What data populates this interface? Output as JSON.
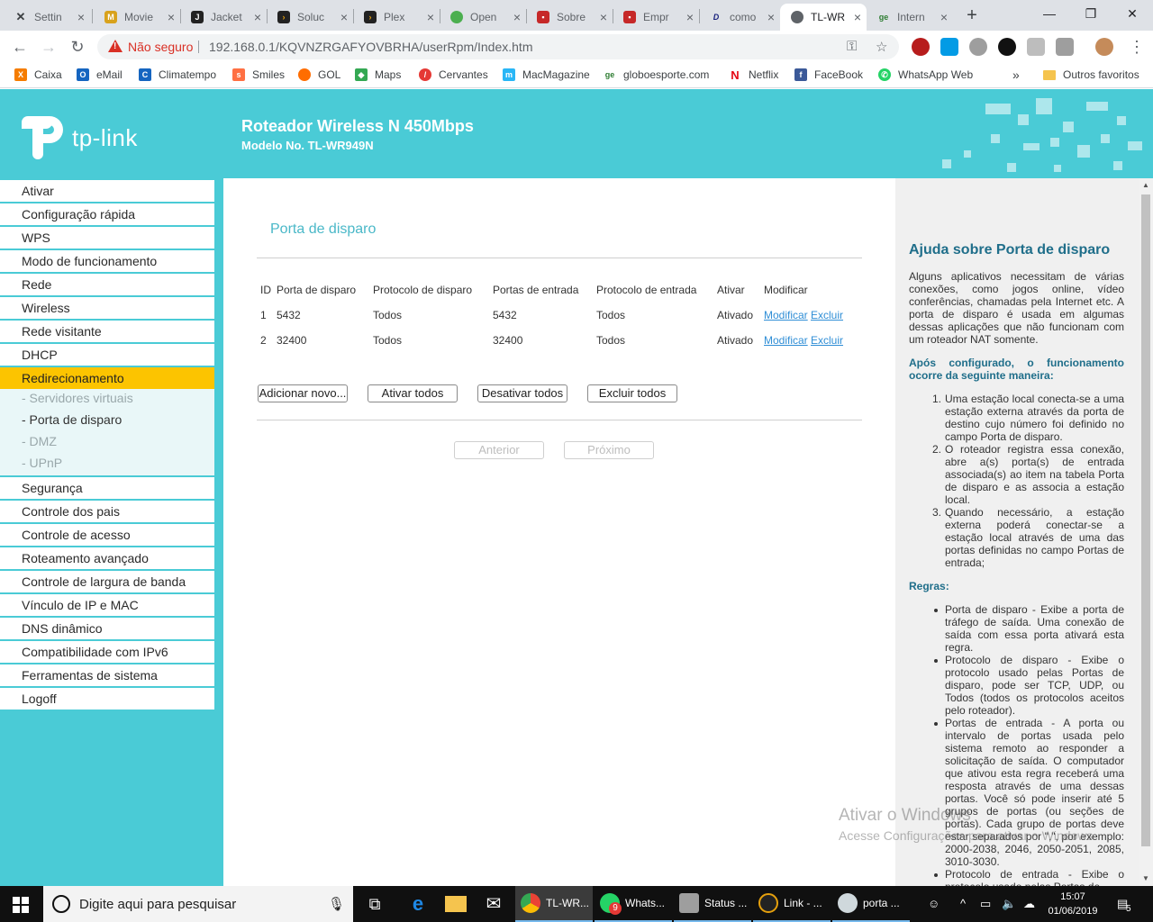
{
  "browser": {
    "tabs": [
      {
        "label": "Settin",
        "color": "#3c4043"
      },
      {
        "label": "Movie",
        "color": "#d8a21c"
      },
      {
        "label": "Jacket",
        "color": "#222222"
      },
      {
        "label": "Soluc",
        "color": "#e5a00d"
      },
      {
        "label": "Plex",
        "color": "#e5a00d"
      },
      {
        "label": "Open",
        "color": "#4caf50"
      },
      {
        "label": "Sobre",
        "color": "#c62828"
      },
      {
        "label": "Empr",
        "color": "#c62828"
      },
      {
        "label": "como",
        "color": "#1a237e"
      },
      {
        "label": "TL-WR",
        "color": "#5f6368"
      },
      {
        "label": "Intern",
        "color": "#2e7d32"
      }
    ],
    "not_secure": "Não seguro",
    "url": "192.168.0.1/KQVNZRGAFYOVBRHA/userRpm/Index.htm",
    "bookmarks": [
      {
        "label": "Caixa",
        "color": "#f57c00"
      },
      {
        "label": "eMail",
        "color": "#1565c0"
      },
      {
        "label": "Climatempo",
        "color": "#1565c0"
      },
      {
        "label": "Smiles",
        "color": "#ff7043"
      },
      {
        "label": "GOL",
        "color": "#ff6d00"
      },
      {
        "label": "Maps",
        "color": "#34a853"
      },
      {
        "label": "Cervantes",
        "color": "#e53935"
      },
      {
        "label": "MacMagazine",
        "color": "#29b6f6"
      },
      {
        "label": "globoesporte.com",
        "color": "#2e7d32"
      },
      {
        "label": "Netflix",
        "color": "#e50914"
      },
      {
        "label": "FaceBook",
        "color": "#3b5998"
      },
      {
        "label": "WhatsApp Web",
        "color": "#25d366"
      }
    ],
    "more_bookmarks": "»",
    "other_favorites": "Outros favoritos"
  },
  "router": {
    "logo": "tp-link",
    "model_title": "Roteador Wireless N 450Mbps",
    "model_no": "Modelo No. TL-WR949N"
  },
  "menu": {
    "items": [
      "Ativar",
      "Configuração rápida",
      "WPS",
      "Modo de funcionamento",
      "Rede",
      "Wireless",
      "Rede visitante",
      "DHCP",
      "Redirecionamento",
      "Segurança",
      "Controle dos pais",
      "Controle de acesso",
      "Roteamento avançado",
      "Controle de largura de banda",
      "Vínculo de IP e MAC",
      "DNS dinâmico",
      "Compatibilidade com IPv6",
      "Ferramentas de sistema",
      "Logoff"
    ],
    "active": "Redirecionamento",
    "subitems": [
      "- Servidores virtuais",
      "- Porta de disparo",
      "- DMZ",
      "- UPnP"
    ]
  },
  "main": {
    "title": "Porta de disparo",
    "columns": [
      "ID",
      "Porta de disparo",
      "Protocolo de disparo",
      "Portas de entrada",
      "Protocolo de entrada",
      "Ativar",
      "Modificar"
    ],
    "rows": [
      {
        "id": "1",
        "trigger_port": "5432",
        "trigger_protocol": "Todos",
        "incoming_ports": "5432",
        "incoming_protocol": "Todos",
        "status": "Ativado",
        "modify": "Modificar",
        "delete": "Excluir"
      },
      {
        "id": "2",
        "trigger_port": "32400",
        "trigger_protocol": "Todos",
        "incoming_ports": "32400",
        "incoming_protocol": "Todos",
        "status": "Ativado",
        "modify": "Modificar",
        "delete": "Excluir"
      }
    ],
    "buttons": {
      "add": "Adicionar novo...",
      "enable_all": "Ativar todos",
      "disable_all": "Desativar todos",
      "delete_all": "Excluir todos",
      "prev": "Anterior",
      "next": "Próximo"
    }
  },
  "help": {
    "title": "Ajuda sobre Porta de disparo",
    "intro": "Alguns aplicativos necessitam de várias conexões, como jogos online, vídeo conferências, chamadas pela Internet etc. A porta de disparo é usada em algumas dessas aplicações que não funcionam com um roteador NAT somente.",
    "how_heading": "Após configurado, o funcionamento ocorre da seguinte maneira:",
    "steps": [
      "Uma estação local conecta-se a uma estação externa através da porta de destino cujo número foi definido no campo Porta de disparo.",
      "O roteador registra essa conexão, abre a(s) porta(s) de entrada associada(s) ao item na tabela Porta de disparo e as associa a estação local.",
      "Quando necessário, a estação externa poderá conectar-se a estação local através de uma das portas definidas no campo Portas de entrada;"
    ],
    "rules_heading": "Regras:",
    "rules": [
      "Porta de disparo - Exibe a porta de tráfego de saída. Uma conexão de saída com essa porta ativará esta regra.",
      "Protocolo de disparo - Exibe o protocolo usado pelas Portas de disparo, pode ser TCP, UDP, ou Todos (todos os protocolos aceitos pelo roteador).",
      "Portas de entrada - A porta ou intervalo de portas usada pelo sistema remoto ao responder a solicitação de saída. O computador que ativou esta regra receberá uma resposta através de uma dessas portas. Você só pode inserir até 5 grupos de portas (ou seções de portas). Cada grupo de portas deve estar separados por \",\", por exemplo: 2000-2038, 2046, 2050-2051, 2085, 3010-3030.",
      "Protocolo de entrada - Exibe o protocolo usado pelas Portas de"
    ]
  },
  "watermark": {
    "line1": "Ativar o Windows",
    "line2": "Acesse Configurações para ativar o Windows."
  },
  "taskbar": {
    "search_placeholder": "Digite aqui para pesquisar",
    "apps": [
      {
        "label": "TL-WR...",
        "color": "#ea4335"
      },
      {
        "label": "Whats...",
        "color": "#25d366",
        "badge": "9"
      },
      {
        "label": "Status ...",
        "color": "#9e9e9e"
      },
      {
        "label": "Link - ...",
        "color": "#e5a00d"
      },
      {
        "label": "porta ...",
        "color": "#cfd8dc"
      }
    ],
    "time": "15:07",
    "date": "01/06/2019",
    "notification_count": "5"
  }
}
